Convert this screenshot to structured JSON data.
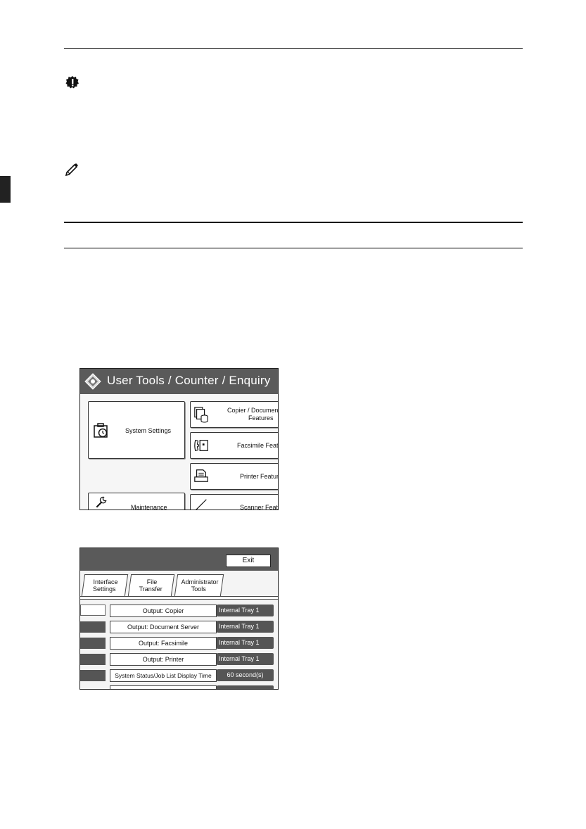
{
  "screens": [
    {
      "header_title": "User Tools / Counter / Enquiry",
      "buttons": {
        "system_settings": "System Settings",
        "copier_line1": "Copier / Document",
        "copier_line2": "Features",
        "facsimile": "Facsimile Feat",
        "printer": "Printer Featur",
        "maintenance": "Maintenance",
        "scanner": "Scanner Featu"
      }
    },
    {
      "exit_label": "Exit",
      "tabs": [
        {
          "line1": "Interface",
          "line2": "Settings"
        },
        {
          "line1": "File",
          "line2": "Transfer"
        },
        {
          "line1": "Administrator",
          "line2": "Tools"
        }
      ],
      "rows": [
        {
          "label": "Output: Copier",
          "value": "Internal Tray 1"
        },
        {
          "label": "Output: Document Server",
          "value": "Internal Tray 1"
        },
        {
          "label": "Output: Facsimile",
          "value": "Internal Tray 1"
        },
        {
          "label": "Output: Printer",
          "value": "Internal Tray 1"
        },
        {
          "label": "System Status/Job List Display Time",
          "value": "60 second(s)"
        }
      ]
    }
  ],
  "icons": [
    "important-icon",
    "note-icon",
    "system-settings-icon",
    "copier-icon",
    "facsimile-icon",
    "printer-icon",
    "maintenance-icon",
    "scanner-icon"
  ]
}
